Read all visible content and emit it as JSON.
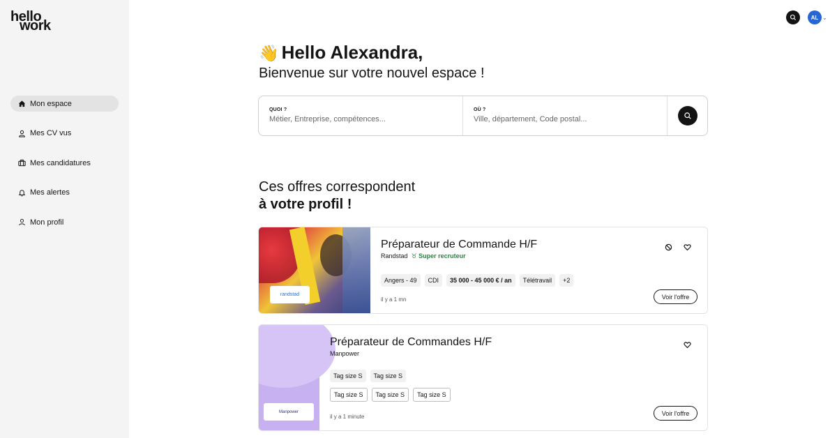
{
  "brand": {
    "logo_line1": "hello",
    "logo_line2": "work"
  },
  "sidebar": {
    "items": [
      {
        "label": "Mon espace",
        "icon": "home-icon",
        "active": true
      },
      {
        "label": "Mes CV vus",
        "icon": "user-icon",
        "active": false
      },
      {
        "label": "Mes candidatures",
        "icon": "briefcase-icon",
        "active": false
      },
      {
        "label": "Mes alertes",
        "icon": "bell-icon",
        "active": false
      },
      {
        "label": "Mon profil",
        "icon": "profile-icon",
        "active": false
      }
    ]
  },
  "header": {
    "avatar_initials": "AL",
    "avatar_color": "#2866d6"
  },
  "greeting": {
    "emoji": "👋",
    "title": "Hello Alexandra,",
    "subtitle": "Bienvenue sur votre nouvel espace !"
  },
  "search": {
    "what_label": "QUOI ?",
    "what_placeholder": "Métier, Entreprise, compétences...",
    "where_label": "OÙ ?",
    "where_placeholder": "Ville, département, Code postal..."
  },
  "offers_section": {
    "title_line1": "Ces offres correspondent",
    "title_line2": "à votre profil !"
  },
  "offers": [
    {
      "title": "Préparateur de Commande H/F",
      "company": "Randstad",
      "badge": "Super recruteur",
      "badge_color": "#1f8b3a",
      "brand_logo_text": "randstad",
      "tags": [
        "Angers - 49",
        "CDI",
        "35 000 - 45 000 € / an",
        "Télétravail",
        "+2"
      ],
      "posted": "il y a 1 mn",
      "cta": "Voir l'offre"
    },
    {
      "title": "Préparateur de Commandes H/F",
      "company": "Manpower",
      "brand_logo_text": "Manpower",
      "tags_row1": [
        "Tag size S",
        "Tag size S"
      ],
      "tags_row2": [
        "Tag size S",
        "Tag size S",
        "Tag size S"
      ],
      "posted": "il y a 1 minute",
      "cta": "Voir l'offre"
    }
  ]
}
